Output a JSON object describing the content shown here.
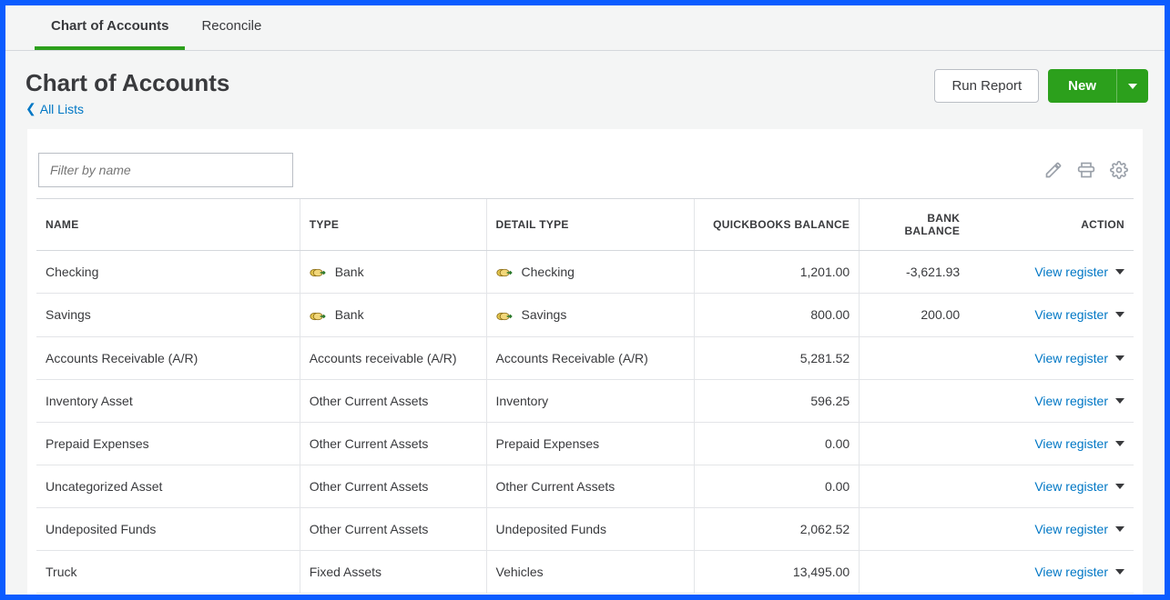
{
  "tabs": [
    {
      "label": "Chart of Accounts",
      "active": true
    },
    {
      "label": "Reconcile",
      "active": false
    }
  ],
  "page_title": "Chart of Accounts",
  "breadcrumb_label": "All Lists",
  "run_report_label": "Run Report",
  "new_label": "New",
  "filter_placeholder": "Filter by name",
  "columns": {
    "name": "NAME",
    "type": "TYPE",
    "detail_type": "DETAIL TYPE",
    "qb_balance": "QUICKBOOKS BALANCE",
    "bank_balance": "BANK BALANCE",
    "action": "ACTION"
  },
  "action_label": "View register",
  "rows": [
    {
      "name": "Checking",
      "type": "Bank",
      "type_icon": true,
      "detail": "Checking",
      "detail_icon": true,
      "qb": "1,201.00",
      "bank": "-3,621.93"
    },
    {
      "name": "Savings",
      "type": "Bank",
      "type_icon": true,
      "detail": "Savings",
      "detail_icon": true,
      "qb": "800.00",
      "bank": "200.00"
    },
    {
      "name": "Accounts Receivable (A/R)",
      "type": "Accounts receivable (A/R)",
      "type_icon": false,
      "detail": "Accounts Receivable (A/R)",
      "detail_icon": false,
      "qb": "5,281.52",
      "bank": ""
    },
    {
      "name": "Inventory Asset",
      "type": "Other Current Assets",
      "type_icon": false,
      "detail": "Inventory",
      "detail_icon": false,
      "qb": "596.25",
      "bank": ""
    },
    {
      "name": "Prepaid Expenses",
      "type": "Other Current Assets",
      "type_icon": false,
      "detail": "Prepaid Expenses",
      "detail_icon": false,
      "qb": "0.00",
      "bank": ""
    },
    {
      "name": "Uncategorized Asset",
      "type": "Other Current Assets",
      "type_icon": false,
      "detail": "Other Current Assets",
      "detail_icon": false,
      "qb": "0.00",
      "bank": ""
    },
    {
      "name": "Undeposited Funds",
      "type": "Other Current Assets",
      "type_icon": false,
      "detail": "Undeposited Funds",
      "detail_icon": false,
      "qb": "2,062.52",
      "bank": ""
    },
    {
      "name": "Truck",
      "type": "Fixed Assets",
      "type_icon": false,
      "detail": "Vehicles",
      "detail_icon": false,
      "qb": "13,495.00",
      "bank": ""
    }
  ]
}
